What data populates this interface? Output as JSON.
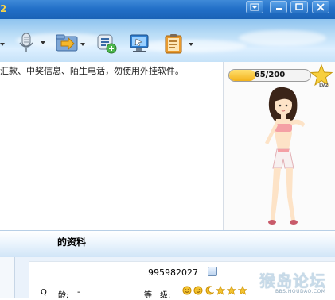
{
  "titlebar": {
    "title_fragment": "2",
    "controls": {
      "menu": "menu-icon",
      "minimize": "minimize-icon",
      "maximize": "maximize-icon",
      "close": "close-icon"
    }
  },
  "toolbar": {
    "buttons": [
      {
        "name": "microphone",
        "icon": "microphone-icon",
        "has_dropdown": true
      },
      {
        "name": "file-transfer",
        "icon": "folder-transfer-icon",
        "has_dropdown": true
      },
      {
        "name": "add-list",
        "icon": "list-add-icon",
        "has_dropdown": false
      },
      {
        "name": "remote-desktop",
        "icon": "monitor-icon",
        "has_dropdown": false
      },
      {
        "name": "apps",
        "icon": "clipboard-icon",
        "has_dropdown": true
      }
    ]
  },
  "notice": {
    "text": "汇款、中奖信息、陌生电话，勿使用外挂软件。"
  },
  "avatar": {
    "xp_text": "65/200",
    "xp_fraction": 0.325,
    "level_label": "LV2",
    "level_icon": "star-icon"
  },
  "profile": {
    "title": "的资料",
    "qq_number": "995982027",
    "row_label_left": "Q",
    "age_label": "龄:",
    "age_value": "-",
    "level_label": "等　级:",
    "level_badges": [
      "sun-icon",
      "sun-icon",
      "moon-icon",
      "star-icon",
      "star-icon",
      "star-icon"
    ]
  },
  "watermark": {
    "text": "猴岛论坛",
    "url": "BBS.HOUDAO.COM"
  },
  "colors": {
    "title_accent": "#f6d24a",
    "xp_fill": "#f3b21c",
    "titlebar": "#2370c8"
  }
}
